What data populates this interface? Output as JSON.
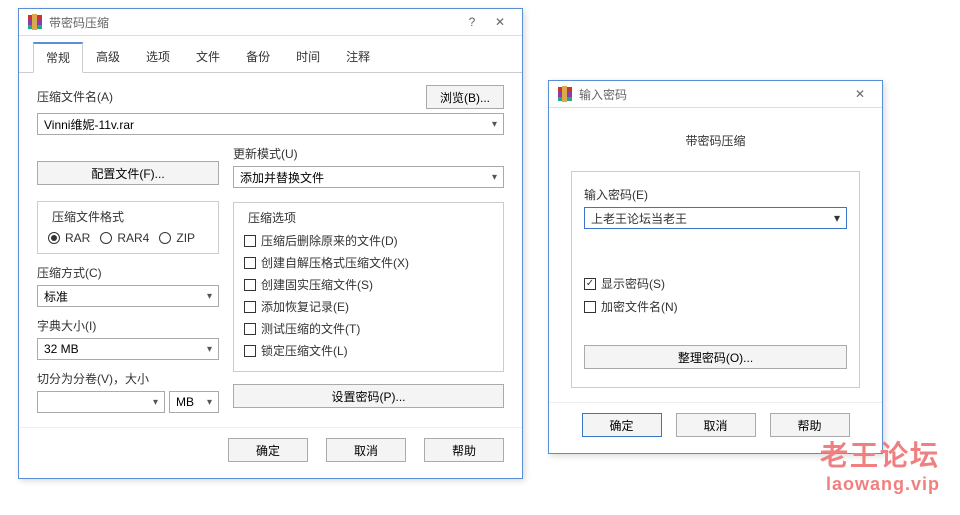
{
  "main": {
    "title": "带密码压缩",
    "help": "?",
    "close": "✕",
    "tabs": [
      "常规",
      "高级",
      "选项",
      "文件",
      "备份",
      "时间",
      "注释"
    ],
    "archiveNameLabel": "压缩文件名(A)",
    "archiveName": "Vinni维妮-11v.rar",
    "browse": "浏览(B)...",
    "profiles": "配置文件(F)...",
    "updateModeLabel": "更新模式(U)",
    "updateMode": "添加并替换文件",
    "formatLabel": "压缩文件格式",
    "formats": [
      "RAR",
      "RAR4",
      "ZIP"
    ],
    "methodLabel": "压缩方式(C)",
    "method": "标准",
    "dictLabel": "字典大小(I)",
    "dict": "32 MB",
    "splitLabel": "切分为分卷(V)，大小",
    "splitUnit": "MB",
    "optionsLabel": "压缩选项",
    "options": [
      "压缩后删除原来的文件(D)",
      "创建自解压格式压缩文件(X)",
      "创建固实压缩文件(S)",
      "添加恢复记录(E)",
      "测试压缩的文件(T)",
      "锁定压缩文件(L)"
    ],
    "setPassword": "设置密码(P)...",
    "ok": "确定",
    "cancel": "取消",
    "helpBtn": "帮助"
  },
  "pw": {
    "title": "输入密码",
    "close": "✕",
    "heading": "带密码压缩",
    "enterLabel": "输入密码(E)",
    "value": "上老王论坛当老王",
    "showPwd": "显示密码(S)",
    "encryptNames": "加密文件名(N)",
    "organize": "整理密码(O)...",
    "ok": "确定",
    "cancel": "取消",
    "helpBtn": "帮助"
  },
  "wm": {
    "l1": "老王论坛",
    "l2": "laowang.vip"
  }
}
